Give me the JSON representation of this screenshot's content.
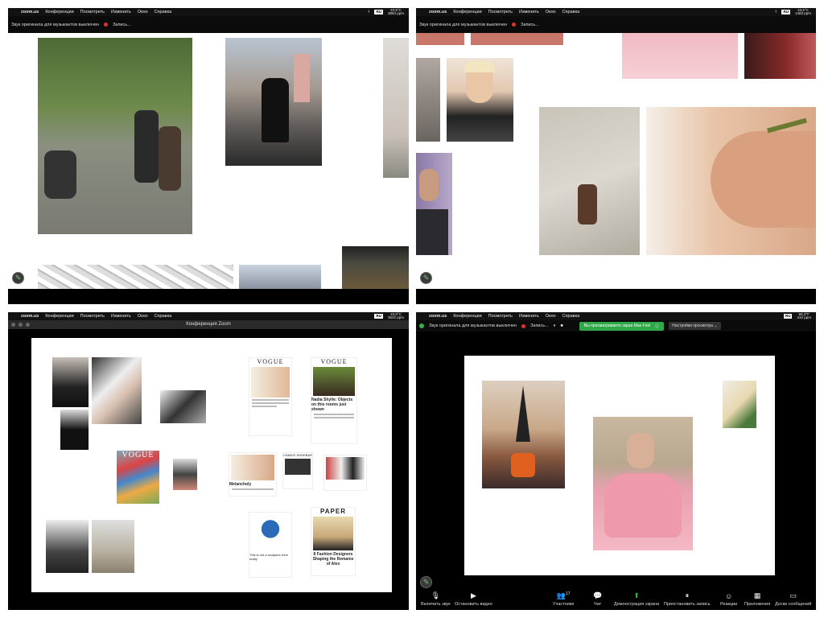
{
  "menubar": {
    "app": "zoom.us",
    "items": [
      "Конференции",
      "Посмотреть",
      "Изменить",
      "Окно",
      "Справка"
    ],
    "keyboard": "RU"
  },
  "panels": {
    "p1": {
      "weather": "23,5°C",
      "weather2": "3864 ppm",
      "notice": "Звук оригинала для музыкантов выключен",
      "record": "Запись..."
    },
    "p2": {
      "weather": "23,5°C",
      "weather2": "1483 ppm",
      "notice": "Звук оригинала для музыкантов выключен",
      "record": "Запись..."
    },
    "p3": {
      "weather": "23,5°C",
      "weather2": "3522 ppm",
      "window_title": "Конференция Zoom"
    },
    "p4": {
      "weather": "66,3°F",
      "weather2": "410 ppm",
      "notice": "Звук оригинала для музыкантов выключен",
      "record": "Запись...",
      "sharing_banner": "Вы просматриваете экран Max Friel",
      "view_options": "Настройки просмотра"
    }
  },
  "mags": {
    "vogue": "VOGUE",
    "vogue_a_caption": "Vogue caption text",
    "vogue_b_title": "Nadia Shylle: Objects on this rooms just shown",
    "paper": "PAPER",
    "paper_title": "8 Fashion Designers Shaping the Remains of Alex",
    "mag_caption": "This is not a sculpture here today",
    "melody": "Melancholy",
    "stack": "CANDIS SHOEBAR"
  },
  "toolbar": [
    {
      "label": "Включить звук",
      "icon": "mic-off-icon"
    },
    {
      "label": "Остановить видео",
      "icon": "video-icon"
    },
    {
      "label": "Участники",
      "icon": "participants-icon",
      "count": "17"
    },
    {
      "label": "Чат",
      "icon": "chat-icon"
    },
    {
      "label": "Демонстрация экрана",
      "icon": "share-screen-icon"
    },
    {
      "label": "Приостановить запись",
      "icon": "pause-record-icon"
    },
    {
      "label": "Реакции",
      "icon": "reactions-icon"
    },
    {
      "label": "Приложения",
      "icon": "apps-icon"
    },
    {
      "label": "Доски сообщений",
      "icon": "whiteboard-icon"
    }
  ],
  "colors": {
    "share_green": "#2fa84a",
    "record_red": "#e03030"
  }
}
